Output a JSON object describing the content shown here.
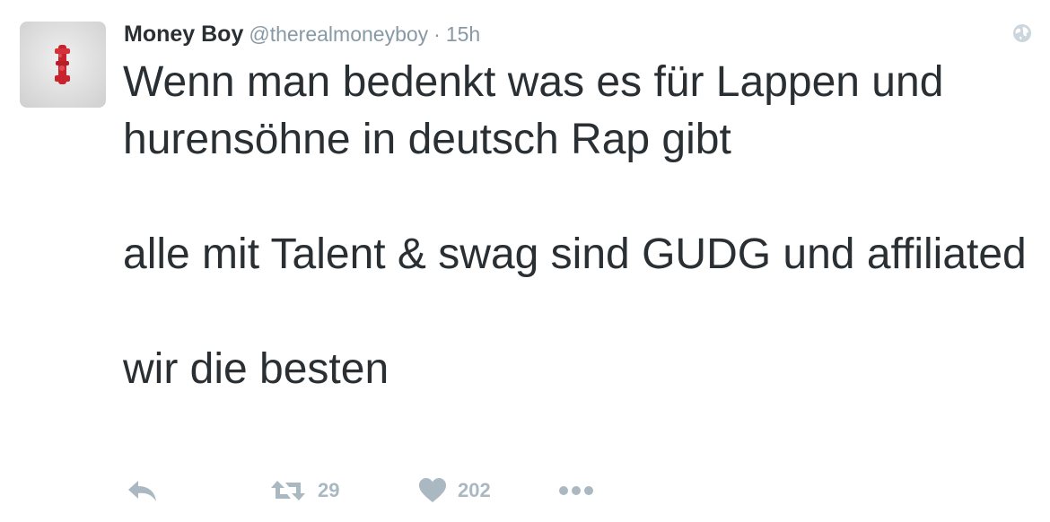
{
  "tweet": {
    "author": {
      "fullname": "Money Boy",
      "username": "@therealmoneyboy"
    },
    "separator": "·",
    "timestamp": "15h",
    "text": "Wenn man bedenkt was es für Lappen und hurensöhne in deutsch Rap gibt\n\nalle mit Talent & swag sind GUDG und affiliated\n\nwir die besten",
    "stats": {
      "retweets": "29",
      "likes": "202"
    }
  },
  "icons": {
    "avatar": "avatar-image",
    "globe": "globe-icon",
    "reply": "reply-icon",
    "retweet": "retweet-icon",
    "like": "heart-icon",
    "more": "more-icon"
  },
  "colors": {
    "text": "#292f33",
    "muted": "#8899a6",
    "action": "#aab8c2",
    "background": "#ffffff"
  }
}
